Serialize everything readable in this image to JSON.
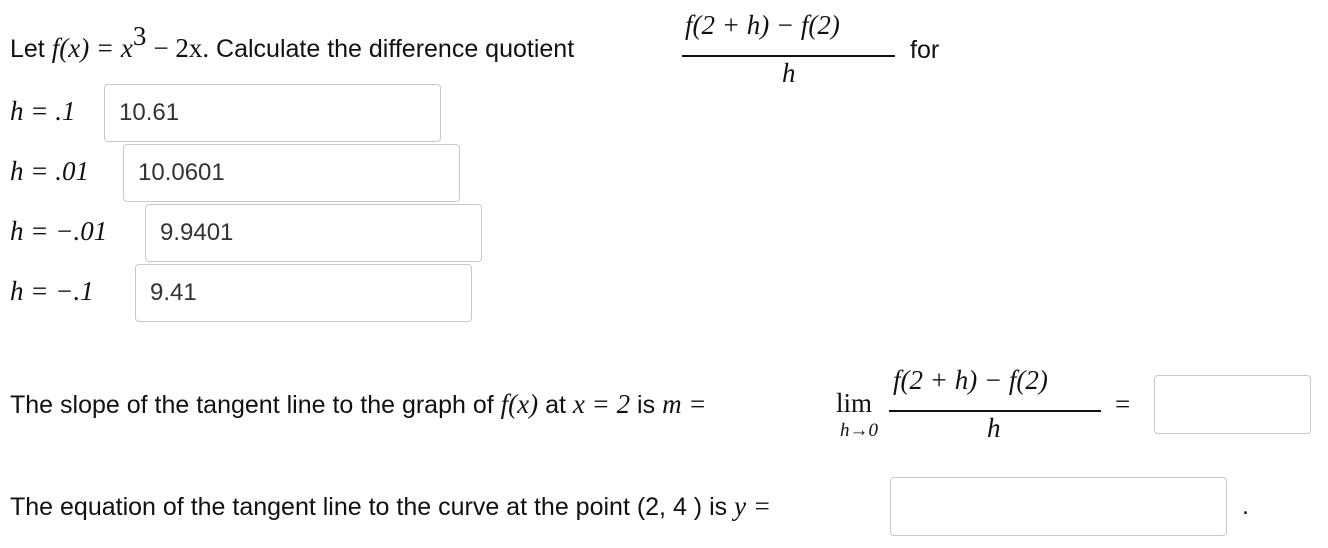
{
  "problem": {
    "let_label": "Let",
    "function_lhs": "f(x) = x",
    "exponent": "3",
    "function_rhs": "− 2x.",
    "instruction": "Calculate the difference quotient",
    "quotient_numerator": "f(2 + h) − f(2)",
    "quotient_denominator": "h",
    "for_label": "for"
  },
  "rows": [
    {
      "h_label": "h = .1",
      "value": "10.61"
    },
    {
      "h_label": "h = .01",
      "value": "10.0601"
    },
    {
      "h_label": "h = −.01",
      "value": "9.9401"
    },
    {
      "h_label": "h = −.1",
      "value": "9.41"
    }
  ],
  "slope": {
    "text_before": "The slope of the tangent line to the graph of",
    "fx": "f(x)",
    "at_label": "at",
    "x_eq": "x = 2",
    "is_label": "is",
    "m_eq": "m =",
    "lim": "lim",
    "lim_sub": "h→0",
    "numerator": "f(2 + h) − f(2)",
    "denominator": "h",
    "equals": "=",
    "answer": ""
  },
  "tangent": {
    "text": "The equation of the tangent line to the curve at the point (2, 4 ) is",
    "y_eq": "y =",
    "answer": "",
    "period": "."
  }
}
